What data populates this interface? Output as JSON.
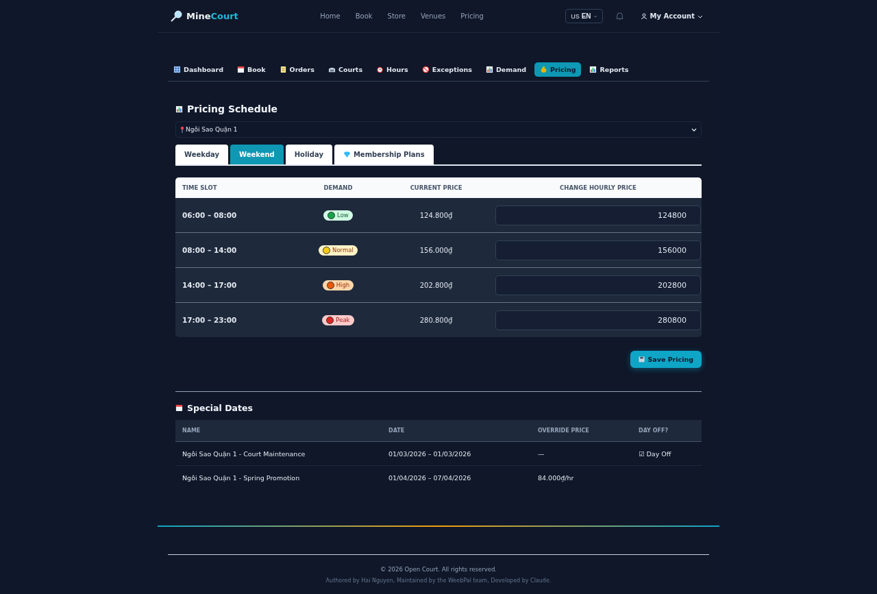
{
  "brand": {
    "part1": "Mine",
    "part2": "Court"
  },
  "nav": [
    "Home",
    "Book",
    "Store",
    "Venues",
    "Pricing"
  ],
  "language": {
    "flag": "US",
    "code": "EN"
  },
  "account": "My Account",
  "admin_tabs": [
    {
      "label": "Dashboard",
      "kind": "building",
      "selected": false
    },
    {
      "label": "Book",
      "kind": "calendar",
      "selected": false
    },
    {
      "label": "Orders",
      "kind": "clipboard",
      "selected": false
    },
    {
      "label": "Courts",
      "kind": "stadium",
      "selected": false
    },
    {
      "label": "Hours",
      "kind": "clock",
      "selected": false
    },
    {
      "label": "Exceptions",
      "kind": "ban",
      "selected": false
    },
    {
      "label": "Demand",
      "kind": "chart",
      "selected": false
    },
    {
      "label": "Pricing",
      "kind": "moneybag",
      "selected": true
    },
    {
      "label": "Reports",
      "kind": "chart",
      "selected": false
    }
  ],
  "title": "Pricing Schedule",
  "venue_select": {
    "value": "Ngôi Sao Quận 1"
  },
  "day_tabs": [
    {
      "label": "Weekday",
      "kind": "plain",
      "selected": false
    },
    {
      "label": "Weekend",
      "kind": "plain",
      "selected": true
    },
    {
      "label": "Holiday",
      "kind": "plain",
      "selected": false
    },
    {
      "label": "Membership Plans",
      "kind": "gem",
      "selected": false
    }
  ],
  "pricing_table": {
    "columns": [
      "TIME SLOT",
      "DEMAND",
      "CURRENT PRICE",
      "CHANGE HOURLY PRICE"
    ],
    "rows": [
      {
        "time_slot": "06:00 – 08:00",
        "demand": "Low",
        "kind": "low",
        "color": "#16a34a",
        "current_price": "124.800₫",
        "new_price": "124800"
      },
      {
        "time_slot": "08:00 – 14:00",
        "demand": "Normal",
        "kind": "normal",
        "color": "#facc15",
        "current_price": "156.000₫",
        "new_price": "156000"
      },
      {
        "time_slot": "14:00 – 17:00",
        "demand": "High",
        "kind": "high",
        "color": "#ea580c",
        "current_price": "202.800₫",
        "new_price": "202800"
      },
      {
        "time_slot": "17:00 – 23:00",
        "demand": "Peak",
        "kind": "peak",
        "color": "#dc2626",
        "current_price": "280.800₫",
        "new_price": "280800"
      }
    ]
  },
  "save_button": "Save Pricing",
  "special_dates": {
    "title": "Special Dates",
    "columns": [
      "NAME",
      "DATE",
      "OVERRIDE PRICE",
      "DAY OFF?"
    ],
    "rows": [
      {
        "name": "Ngôi Sao Quận 1 - Court Maintenance",
        "date": "01/03/2026 – 01/03/2026",
        "override_price": "—",
        "day_off": "☑ Day Off"
      },
      {
        "name": "Ngôi Sao Quận 1 - Spring Promotion",
        "date": "01/04/2026 – 07/04/2026",
        "override_price": "84.000₫/hr"
      }
    ]
  },
  "footer": {
    "copyright": "© 2026 Open Court. All rights reserved.",
    "credits": "Authored by Hai Nguyen, Maintained by the WeebPal team, Developed by Claude."
  }
}
